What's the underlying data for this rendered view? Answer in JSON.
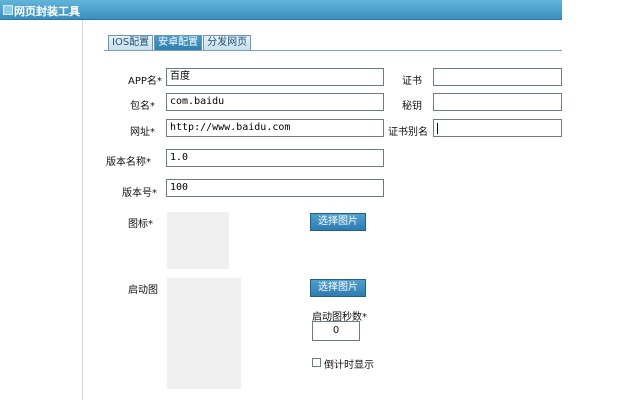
{
  "window": {
    "title": "网页封装工具"
  },
  "tabs": [
    {
      "label": "IOS配置"
    },
    {
      "label": "安卓配置"
    },
    {
      "label": "分发网页"
    }
  ],
  "form": {
    "app_name_label": "APP名*",
    "app_name_value": "百度",
    "package_label": "包名*",
    "package_value": "com.baidu",
    "url_label": "网址*",
    "url_value": "http://www.baidu.com",
    "version_name_label": "版本名称*",
    "version_name_value": "1.0",
    "version_code_label": "版本号*",
    "version_code_value": "100",
    "icon_label": "图标*",
    "splash_label": "启动图"
  },
  "right_fields": {
    "cert_label": "证书",
    "secret_label": "秘钥",
    "alias_label": "证书别名"
  },
  "buttons": {
    "select_icon": "选择图片",
    "select_splash": "选择图片"
  },
  "splash_settings": {
    "seconds_label": "启动图秒数*",
    "seconds_value": "0",
    "countdown_label": "倒计时显示"
  }
}
